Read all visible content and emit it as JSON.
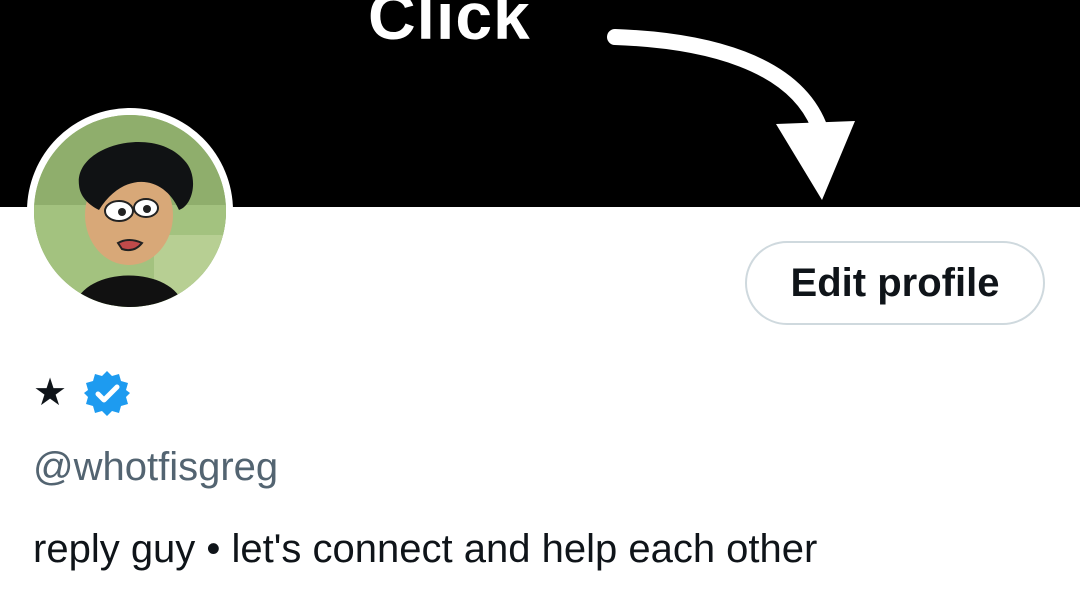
{
  "banner": {
    "text": "Click"
  },
  "profile": {
    "display_name": "★",
    "verified_icon": "verified-badge-icon",
    "handle": "@whotfisgreg",
    "bio": "reply guy • let's connect and help each other"
  },
  "actions": {
    "edit_profile_label": "Edit profile"
  },
  "colors": {
    "banner_bg": "#000000",
    "verified_blue": "#1d9bf0",
    "handle_gray": "#536471",
    "border_gray": "#cfd9de"
  }
}
